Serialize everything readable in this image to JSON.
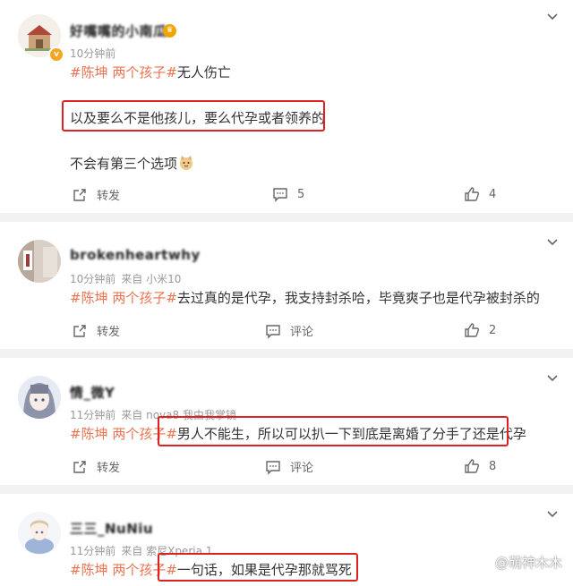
{
  "posts": [
    {
      "username": "好嘴嘴的小南瓜",
      "meta_time": "10分钟前",
      "meta_source": "",
      "topic": "#陈坤 两个孩子#",
      "lines": [
        "无人伤亡",
        "以及要么不是他孩儿，要么代孕或者领养的",
        "不会有第三个选项"
      ],
      "repost_label": "转发",
      "comment_label": "5",
      "like_count": "4"
    },
    {
      "username": "brokenheartwhy",
      "meta_time": "10分钟前",
      "meta_source": "来自 小米10",
      "topic": "#陈坤 两个孩子#",
      "lines": [
        "去过真的是代孕，我支持封杀哈，毕竟爽子也是代孕被封杀的"
      ],
      "repost_label": "转发",
      "comment_label": "评论",
      "like_count": "2"
    },
    {
      "username": "情_微Y",
      "meta_time": "11分钟前",
      "meta_source": "来自 nova8 我由我掌镜",
      "topic": "#陈坤 两个孩子#",
      "lines": [
        "男人不能生，所以可以扒一下到底是离婚了分手了还是代孕"
      ],
      "repost_label": "转发",
      "comment_label": "评论",
      "like_count": "8"
    },
    {
      "username": "三三_NuNiu",
      "meta_time": "11分钟前",
      "meta_source": "来自 索尼Xperia 1",
      "topic": "#陈坤 两个孩子#",
      "lines": [
        "一句话，如果是代孕那就骂死"
      ]
    }
  ],
  "watermark": "@萌神木木",
  "colors": {
    "topic": "#eb7350",
    "highlight_box": "#e02020",
    "divider": "#f2f2f2",
    "meta": "#999999",
    "verified_badge": "#f5a623"
  },
  "icons": {
    "repost": "repost-icon",
    "comment": "comment-icon",
    "like": "thumbs-up-icon",
    "menu": "chevron-down-icon"
  }
}
